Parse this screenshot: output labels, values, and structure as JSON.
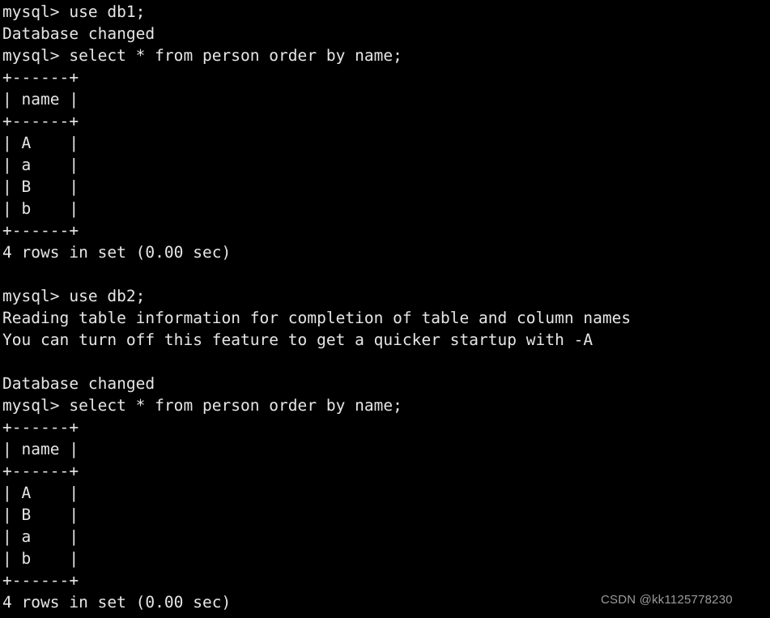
{
  "terminal": {
    "background_color": "#000000",
    "text_color": "#e6e6e6",
    "prompt": "mysql>",
    "lines": [
      "mysql> use db1;",
      "Database changed",
      "mysql> select * from person order by name;",
      "+------+",
      "| name |",
      "+------+",
      "| A    |",
      "| a    |",
      "| B    |",
      "| b    |",
      "+------+",
      "4 rows in set (0.00 sec)",
      "",
      "mysql> use db2;",
      "Reading table information for completion of table and column names",
      "You can turn off this feature to get a quicker startup with -A",
      "",
      "Database changed",
      "mysql> select * from person order by name;",
      "+------+",
      "| name |",
      "+------+",
      "| A    |",
      "| B    |",
      "| a    |",
      "| b    |",
      "+------+",
      "4 rows in set (0.00 sec)"
    ],
    "sessions": [
      {
        "database": "db1",
        "use_command": "mysql> use db1;",
        "use_response": "Database changed",
        "query": "mysql> select * from person order by name;",
        "result": {
          "separator": "+------+",
          "header_row": "| name |",
          "columns": [
            "name"
          ],
          "rows": [
            {
              "cell": "| A    |",
              "value": "A"
            },
            {
              "cell": "| a    |",
              "value": "a"
            },
            {
              "cell": "| B    |",
              "value": "B"
            },
            {
              "cell": "| b    |",
              "value": "b"
            }
          ],
          "row_values": [
            "A",
            "a",
            "B",
            "b"
          ],
          "status": "4 rows in set (0.00 sec)",
          "row_count": 4,
          "duration": "0.00 sec"
        }
      },
      {
        "database": "db2",
        "use_command": "mysql> use db2;",
        "notice_line_1": "Reading table information for completion of table and column names",
        "notice_line_2": "You can turn off this feature to get a quicker startup with -A",
        "use_response": "Database changed",
        "query": "mysql> select * from person order by name;",
        "result": {
          "separator": "+------+",
          "header_row": "| name |",
          "columns": [
            "name"
          ],
          "rows": [
            {
              "cell": "| A    |",
              "value": "A"
            },
            {
              "cell": "| B    |",
              "value": "B"
            },
            {
              "cell": "| a    |",
              "value": "a"
            },
            {
              "cell": "| b    |",
              "value": "b"
            }
          ],
          "row_values": [
            "A",
            "B",
            "a",
            "b"
          ],
          "status": "4 rows in set (0.00 sec)",
          "row_count": 4,
          "duration": "0.00 sec"
        }
      }
    ]
  },
  "watermark": {
    "text": "CSDN @kk1125778230",
    "color": "#9b9b9b"
  }
}
